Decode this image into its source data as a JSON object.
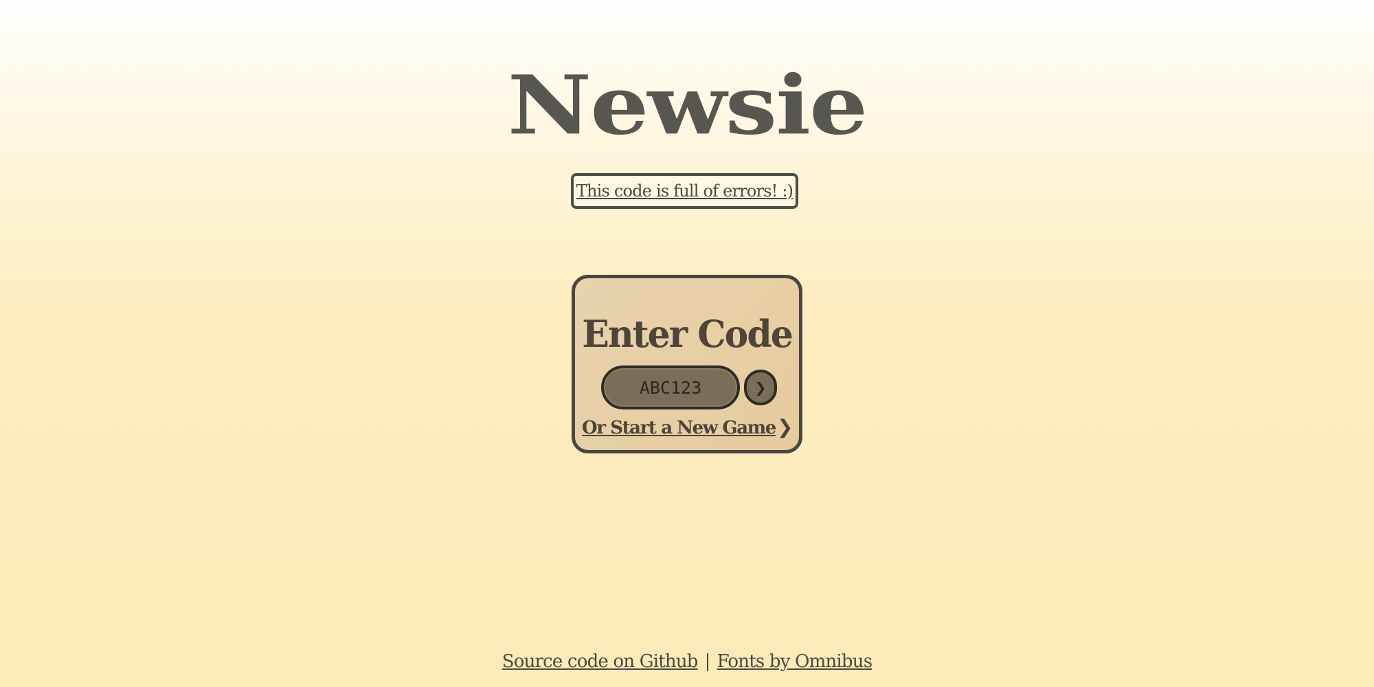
{
  "header": {
    "logo_text": "Newsie",
    "error_link": "This code is full of errors! :)"
  },
  "join_card": {
    "title": "Enter Code",
    "code_placeholder": "ABC123",
    "go_label": "❯",
    "new_game_label": "Or Start a New Game",
    "new_game_chevron": "❯"
  },
  "footer": {
    "source_link": "Source code on Github",
    "separator": "|",
    "fonts_link": "Fonts by Omnibus"
  },
  "colors": {
    "background_top": "#ffffff",
    "background_bottom": "#fcebb8",
    "card_background": "#e8d3af",
    "input_background": "#7a6e58",
    "text_dark": "#4f4438"
  }
}
